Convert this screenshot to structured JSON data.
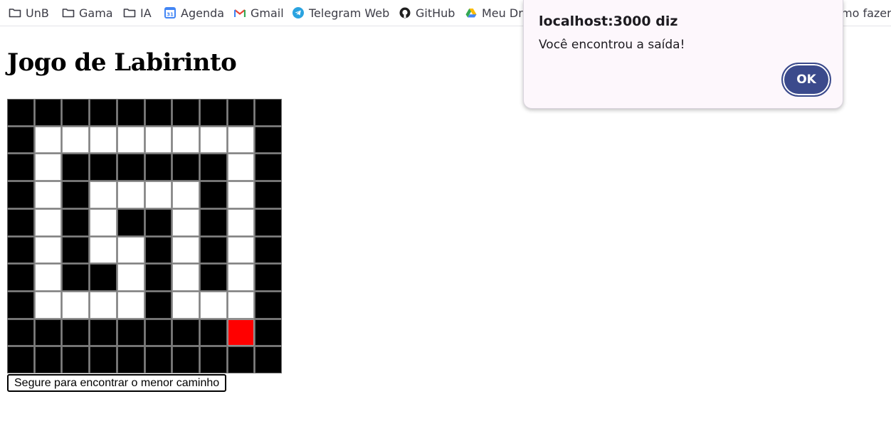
{
  "bookmarks": [
    {
      "label": "UnB",
      "icon": "folder-icon"
    },
    {
      "label": "Gama",
      "icon": "folder-icon"
    },
    {
      "label": "IA",
      "icon": "folder-icon"
    },
    {
      "label": "Agenda",
      "icon": "google-calendar-icon"
    },
    {
      "label": "Gmail",
      "icon": "gmail-icon"
    },
    {
      "label": "Telegram Web",
      "icon": "telegram-icon"
    },
    {
      "label": "GitHub",
      "icon": "github-icon"
    },
    {
      "label": "Meu Dri",
      "icon": "google-drive-icon"
    },
    {
      "label": "mo fazer",
      "icon": ""
    }
  ],
  "page": {
    "title": "Jogo de Labirinto",
    "solve_button": "Segure para encontrar o menor caminho"
  },
  "maze": {
    "rows": [
      [
        1,
        1,
        1,
        1,
        1,
        1,
        1,
        1,
        1,
        1
      ],
      [
        1,
        0,
        0,
        0,
        0,
        0,
        0,
        0,
        0,
        1
      ],
      [
        1,
        0,
        1,
        1,
        1,
        1,
        1,
        1,
        0,
        1
      ],
      [
        1,
        0,
        1,
        0,
        0,
        0,
        0,
        1,
        0,
        1
      ],
      [
        1,
        0,
        1,
        0,
        1,
        1,
        0,
        1,
        0,
        1
      ],
      [
        1,
        0,
        1,
        0,
        0,
        1,
        0,
        1,
        0,
        1
      ],
      [
        1,
        0,
        1,
        1,
        0,
        1,
        0,
        1,
        0,
        1
      ],
      [
        1,
        0,
        0,
        0,
        0,
        1,
        0,
        0,
        0,
        1
      ],
      [
        1,
        1,
        1,
        1,
        1,
        1,
        1,
        1,
        2,
        1
      ],
      [
        1,
        1,
        1,
        1,
        1,
        1,
        1,
        1,
        1,
        1
      ]
    ],
    "legend": {
      "wall": 1,
      "path": 0,
      "current": 2
    }
  },
  "dialog": {
    "title": "localhost:3000 diz",
    "message": "Você encontrou a saída!",
    "ok_label": "OK"
  },
  "colors": {
    "wall": "#000000",
    "path": "#ffffff",
    "current": "#ff0000",
    "ok_button": "#3b4a8c",
    "dialog_bg": "#fdf7fc"
  }
}
